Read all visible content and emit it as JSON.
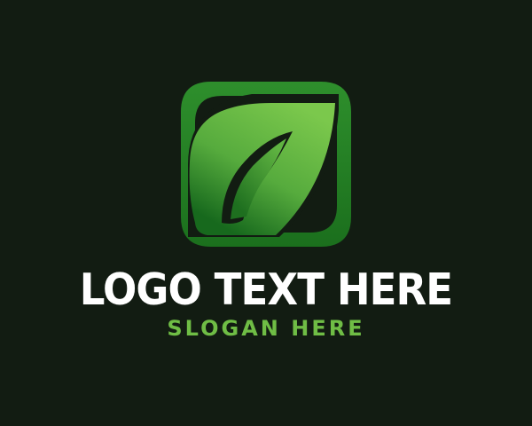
{
  "logo": {
    "icon_name": "leaf-icon",
    "brand_text": "LOGO TEXT HERE",
    "slogan": "SLOGAN HERE"
  },
  "colors": {
    "background": "#121c12",
    "brand_text": "#ffffff",
    "slogan": "#6fbd45",
    "green_light": "#76c44a",
    "green_dark": "#17691d"
  }
}
